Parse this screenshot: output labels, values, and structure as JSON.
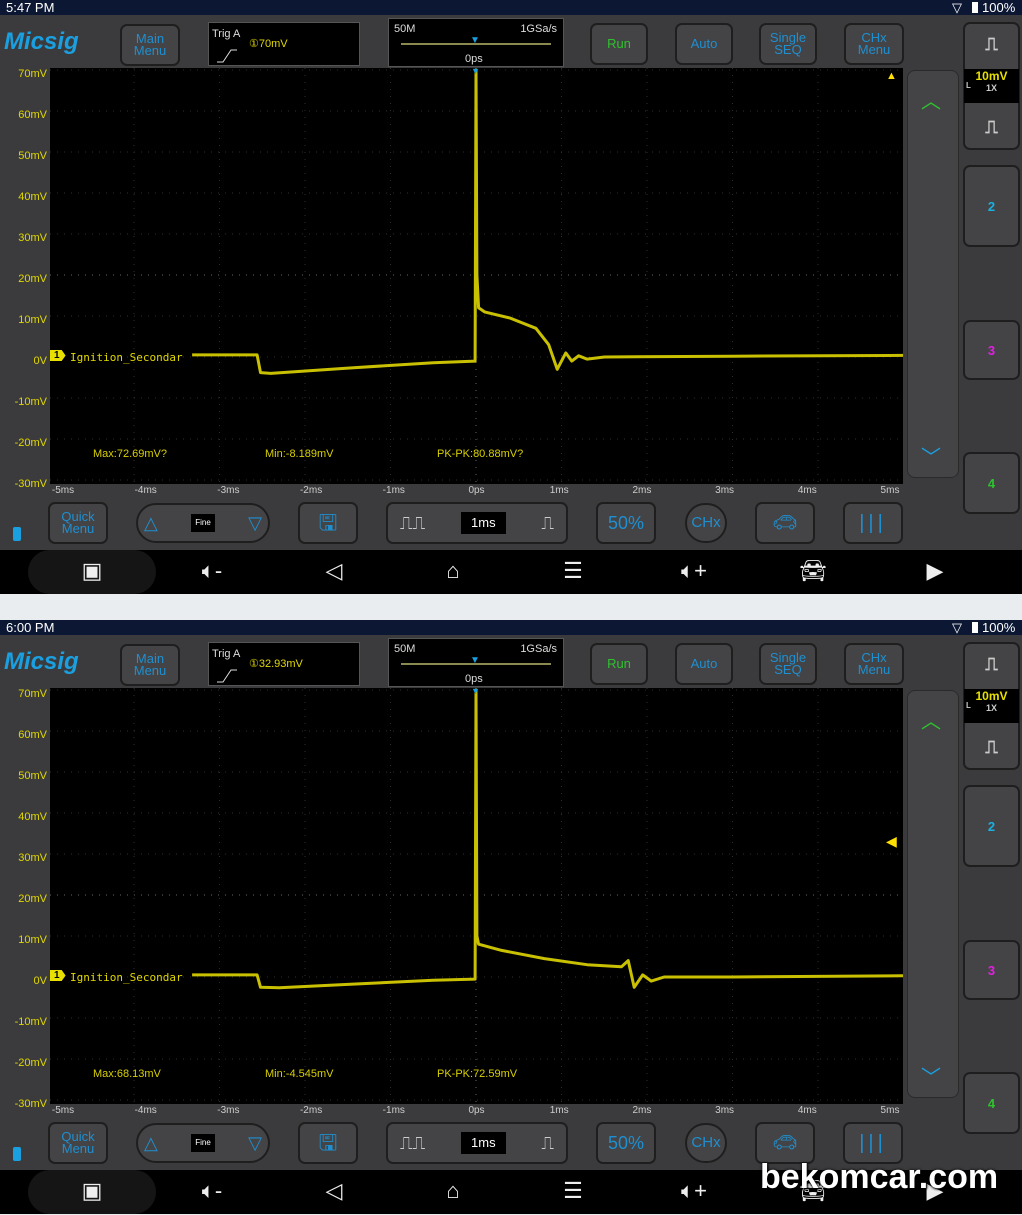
{
  "colors": {
    "trace": "#c8c000",
    "accent": "#1f8fd0",
    "run": "#2fc12f",
    "background": "#000000"
  },
  "panels": [
    {
      "status": {
        "time": "5:47 PM",
        "battery": "100%"
      },
      "logo": "Micsig",
      "buttons": {
        "main_menu": "Main Menu",
        "run": "Run",
        "auto": "Auto",
        "single_seq": "Single SEQ",
        "chx_menu": "CHx Menu",
        "quick_menu": "Quick Menu",
        "fine": "Fine",
        "timebase": "1ms",
        "fifty": "50%",
        "chx": "CHx"
      },
      "trigger": {
        "label": "Trig A",
        "level": "①70mV",
        "level_mv": 70
      },
      "acq": {
        "memory": "50M",
        "rate": "1GSa/s",
        "position": "0ps"
      },
      "channel1": {
        "scale": "10mV",
        "coupling": "L",
        "probe": "1X",
        "label": "Ignition_Secondar",
        "marker": "1"
      },
      "channels": [
        "2",
        "3",
        "4"
      ],
      "y_labels": [
        "70mV",
        "60mV",
        "50mV",
        "40mV",
        "30mV",
        "20mV",
        "10mV",
        "0V",
        "-10mV",
        "-20mV",
        "-30mV"
      ],
      "x_labels": [
        "-5ms",
        "-4ms",
        "-3ms",
        "-2ms",
        "-1ms",
        "0ps",
        "1ms",
        "2ms",
        "3ms",
        "4ms",
        "5ms"
      ],
      "measurements": {
        "max": "Max:72.69mV?",
        "min": "Min:-8.189mV",
        "pkpk": "PK-PK:80.88mV?"
      },
      "trace": [
        [
          -3.32,
          0.5
        ],
        [
          -2.56,
          0.5
        ],
        [
          -2.52,
          -3.8
        ],
        [
          -2.4,
          -4
        ],
        [
          -1.5,
          -2.7
        ],
        [
          -0.5,
          -1.4
        ],
        [
          -0.01,
          -1
        ],
        [
          0,
          70
        ],
        [
          0.01,
          20
        ],
        [
          0.03,
          12
        ],
        [
          0.1,
          11
        ],
        [
          0.4,
          9.5
        ],
        [
          0.7,
          7
        ],
        [
          0.85,
          3
        ],
        [
          0.95,
          -3
        ],
        [
          1.0,
          -1
        ],
        [
          1.05,
          1
        ],
        [
          1.12,
          -1
        ],
        [
          1.2,
          0.3
        ],
        [
          1.3,
          -0.5
        ],
        [
          1.5,
          0
        ],
        [
          3,
          0.2
        ],
        [
          5,
          0.4
        ]
      ]
    },
    {
      "status": {
        "time": "6:00 PM",
        "battery": "100%"
      },
      "logo": "Micsig",
      "buttons": {
        "main_menu": "Main Menu",
        "run": "Run",
        "auto": "Auto",
        "single_seq": "Single SEQ",
        "chx_menu": "CHx Menu",
        "quick_menu": "Quick Menu",
        "fine": "Fine",
        "timebase": "1ms",
        "fifty": "50%",
        "chx": "CHx"
      },
      "trigger": {
        "label": "Trig A",
        "level": "①32.93mV",
        "level_mv": 32.93
      },
      "acq": {
        "memory": "50M",
        "rate": "1GSa/s",
        "position": "0ps"
      },
      "channel1": {
        "scale": "10mV",
        "coupling": "L",
        "probe": "1X",
        "label": "Ignition_Secondar",
        "marker": "1"
      },
      "channels": [
        "2",
        "3",
        "4"
      ],
      "y_labels": [
        "70mV",
        "60mV",
        "50mV",
        "40mV",
        "30mV",
        "20mV",
        "10mV",
        "0V",
        "-10mV",
        "-20mV",
        "-30mV"
      ],
      "x_labels": [
        "-5ms",
        "-4ms",
        "-3ms",
        "-2ms",
        "-1ms",
        "0ps",
        "1ms",
        "2ms",
        "3ms",
        "4ms",
        "5ms"
      ],
      "measurements": {
        "max": "Max:68.13mV",
        "min": "Min:-4.545mV",
        "pkpk": "PK-PK:72.59mV"
      },
      "trace": [
        [
          -3.32,
          0.5
        ],
        [
          -2.56,
          0.5
        ],
        [
          -2.52,
          -2.5
        ],
        [
          -2.3,
          -2.6
        ],
        [
          -1.5,
          -1.8
        ],
        [
          -0.5,
          -0.8
        ],
        [
          -0.01,
          -0.5
        ],
        [
          0,
          70
        ],
        [
          0.01,
          10
        ],
        [
          0.03,
          8
        ],
        [
          0.3,
          6.5
        ],
        [
          0.8,
          4.5
        ],
        [
          1.3,
          3
        ],
        [
          1.7,
          2.5
        ],
        [
          1.78,
          4
        ],
        [
          1.85,
          -2.5
        ],
        [
          1.95,
          0.5
        ],
        [
          2.05,
          -1
        ],
        [
          2.2,
          0
        ],
        [
          3,
          0
        ],
        [
          5,
          0.3
        ]
      ]
    }
  ],
  "watermark": "bekomcar.com"
}
